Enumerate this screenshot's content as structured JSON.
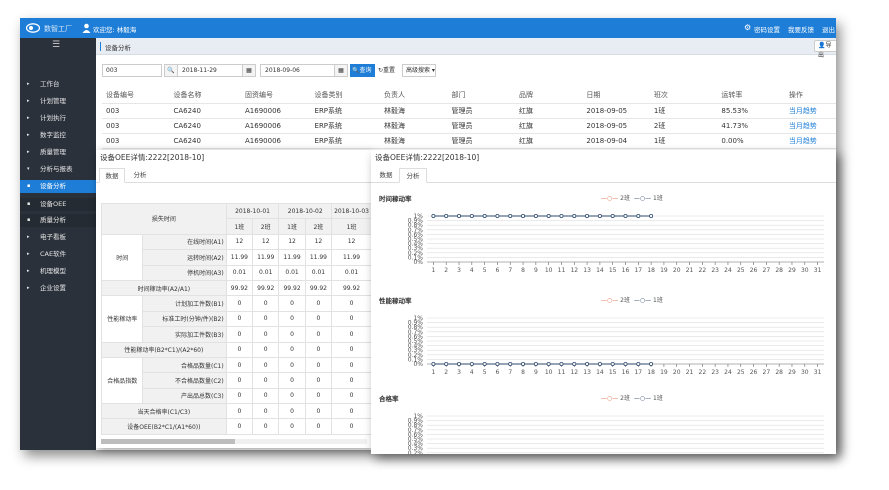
{
  "app": {
    "brand": "数智工厂",
    "welcome": "欢迎您: 林毅海",
    "top_links": [
      "密码设置",
      "我要反馈",
      "退出"
    ]
  },
  "sidebar": {
    "items": [
      {
        "label": "工作台",
        "type": "group"
      },
      {
        "label": "计划管理",
        "type": "group"
      },
      {
        "label": "计划执行",
        "type": "group"
      },
      {
        "label": "数字监控",
        "type": "group"
      },
      {
        "label": "质量管理",
        "type": "group"
      },
      {
        "label": "分析与报表",
        "type": "open"
      },
      {
        "label": "设备分析",
        "type": "active"
      },
      {
        "label": "设备OEE",
        "type": "sub"
      },
      {
        "label": "质量分析",
        "type": "sub"
      },
      {
        "label": "电子看板",
        "type": "group"
      },
      {
        "label": "CAE软件",
        "type": "group"
      },
      {
        "label": "机理模型",
        "type": "group"
      },
      {
        "label": "企业设置",
        "type": "group"
      }
    ]
  },
  "breadcrumb": {
    "label": "设备分析",
    "right_btn": "导出"
  },
  "filters": {
    "device": "003",
    "date_from": "2018-11-29",
    "date_to": "2018-09-06",
    "query": "查询",
    "reset": "重置",
    "advanced": "高级搜索"
  },
  "bg_table": {
    "headers": [
      "设备编号",
      "设备名称",
      "固资编号",
      "设备类别",
      "负责人",
      "部门",
      "品牌",
      "日期",
      "班次",
      "运转率",
      "操作"
    ],
    "rows": [
      [
        "003",
        "CA6240",
        "A1690006",
        "ERP系统",
        "林毅海",
        "管理员",
        "红旗",
        "2018-09-05",
        "1班",
        "85.53%",
        "当月趋势"
      ],
      [
        "003",
        "CA6240",
        "A1690006",
        "ERP系统",
        "林毅海",
        "管理员",
        "红旗",
        "2018-09-05",
        "2班",
        "41.73%",
        "当月趋势"
      ],
      [
        "003",
        "CA6240",
        "A1690006",
        "ERP系统",
        "林毅海",
        "管理员",
        "红旗",
        "2018-09-04",
        "1班",
        "0.00%",
        "当月趋势"
      ]
    ]
  },
  "left_panel": {
    "title": "设备OEE详情:2222[2018-10]",
    "tabs": [
      "数据",
      "分析"
    ],
    "loss_header": "损失时间",
    "dates": [
      "2018-10-01",
      "2018-10-02",
      "2018-10-03"
    ],
    "shifts": [
      "1班",
      "2班",
      "1班",
      "2班",
      "1班"
    ],
    "groups": {
      "time": "时间",
      "perf": "性能稼动率",
      "qual": "合格品指数"
    },
    "rows": [
      {
        "label": "在线时间(A1)",
        "values": [
          "12",
          "12",
          "12",
          "12",
          "12"
        ]
      },
      {
        "label": "运转时间(A2)",
        "values": [
          "11.99",
          "11.99",
          "11.99",
          "11.99",
          "11.99"
        ]
      },
      {
        "label": "停机时间(A3)",
        "values": [
          "0.01",
          "0.01",
          "0.01",
          "0.01",
          "0.01"
        ]
      },
      {
        "label": "时间稼动率(A2/A1)",
        "values": [
          "99.92",
          "99.92",
          "99.92",
          "99.92",
          "99.92"
        ]
      },
      {
        "label": "计划加工件数(B1)",
        "values": [
          "0",
          "0",
          "0",
          "0",
          "0"
        ]
      },
      {
        "label": "标准工时(分钟/件)(B2)",
        "values": [
          "0",
          "0",
          "0",
          "0",
          "0"
        ]
      },
      {
        "label": "实际加工件数(B3)",
        "values": [
          "0",
          "0",
          "0",
          "0",
          "0"
        ]
      },
      {
        "label": "性能稼动率(B2*C1)/(A2*60)",
        "values": [
          "0",
          "0",
          "0",
          "0",
          "0"
        ]
      },
      {
        "label": "合格品数量(C1)",
        "values": [
          "0",
          "0",
          "0",
          "0",
          "0"
        ]
      },
      {
        "label": "不合格品数量(C2)",
        "values": [
          "0",
          "0",
          "0",
          "0",
          "0"
        ]
      },
      {
        "label": "产出品总数(C3)",
        "values": [
          "0",
          "0",
          "0",
          "0",
          "0"
        ]
      },
      {
        "label": "当天合格率(C1/C3)",
        "values": [
          "0",
          "0",
          "0",
          "0",
          "0"
        ]
      },
      {
        "label": "设备OEE(B2*C1/(A1*60))",
        "values": [
          "0",
          "0",
          "0",
          "0",
          "0"
        ]
      }
    ]
  },
  "right_panel": {
    "title": "设备OEE详情:2222[2018-10]",
    "tabs": [
      "数据",
      "分析"
    ]
  },
  "colors": {
    "series_2": "#e06b4c",
    "series_1": "#2f4a6e",
    "brand": "#1e7ed7"
  },
  "chart_data": [
    {
      "type": "line",
      "title": "时间稼动率",
      "x": [
        1,
        2,
        3,
        4,
        5,
        6,
        7,
        8,
        9,
        10,
        11,
        12,
        13,
        14,
        15,
        16,
        17,
        18,
        19,
        20,
        21,
        22,
        23,
        24,
        25,
        26,
        27,
        28,
        29,
        30,
        31
      ],
      "yticks": [
        "0%",
        "0.1%",
        "0.2%",
        "0.3%",
        "0.4%",
        "0.5%",
        "0.6%",
        "0.7%",
        "0.8%",
        "0.9%",
        "1%"
      ],
      "ylim": [
        0,
        1
      ],
      "legend": [
        "2班",
        "1班"
      ],
      "series": [
        {
          "name": "1班",
          "x": [
            1,
            2,
            3,
            4,
            5,
            6,
            7,
            8,
            9,
            10,
            11,
            12,
            13,
            14,
            15,
            16,
            17,
            18
          ],
          "values": [
            1,
            1,
            1,
            1,
            1,
            1,
            1,
            1,
            1,
            1,
            1,
            1,
            1,
            1,
            1,
            1,
            1,
            1
          ]
        }
      ]
    },
    {
      "type": "line",
      "title": "性能稼动率",
      "x": [
        1,
        2,
        3,
        4,
        5,
        6,
        7,
        8,
        9,
        10,
        11,
        12,
        13,
        14,
        15,
        16,
        17,
        18,
        19,
        20,
        21,
        22,
        23,
        24,
        25,
        26,
        27,
        28,
        29,
        30,
        31
      ],
      "yticks": [
        "0%",
        "0.1%",
        "0.2%",
        "0.3%",
        "0.4%",
        "0.5%",
        "0.6%",
        "0.7%",
        "0.8%",
        "0.9%",
        "1%"
      ],
      "ylim": [
        0,
        1
      ],
      "legend": [
        "2班",
        "1班"
      ],
      "series": [
        {
          "name": "1班",
          "x": [
            1,
            2,
            3,
            4,
            5,
            6,
            7,
            8,
            9,
            10,
            11,
            12,
            13,
            14,
            15,
            16,
            17,
            18
          ],
          "values": [
            0,
            0,
            0,
            0,
            0,
            0,
            0,
            0,
            0,
            0,
            0,
            0,
            0,
            0,
            0,
            0,
            0,
            0
          ]
        }
      ]
    },
    {
      "type": "line",
      "title": "合格率",
      "x": [
        1,
        2,
        3,
        4,
        5,
        6,
        7,
        8,
        9,
        10,
        11,
        12,
        13,
        14,
        15,
        16,
        17,
        18,
        19,
        20,
        21,
        22,
        23,
        24,
        25,
        26,
        27,
        28,
        29,
        30,
        31
      ],
      "yticks": [
        "0%",
        "0.1%",
        "0.2%",
        "0.3%",
        "0.4%",
        "0.5%",
        "0.6%",
        "0.7%",
        "0.8%",
        "0.9%",
        "1%"
      ],
      "ylim": [
        0,
        1
      ],
      "legend": [
        "2班",
        "1班"
      ],
      "series": []
    }
  ]
}
